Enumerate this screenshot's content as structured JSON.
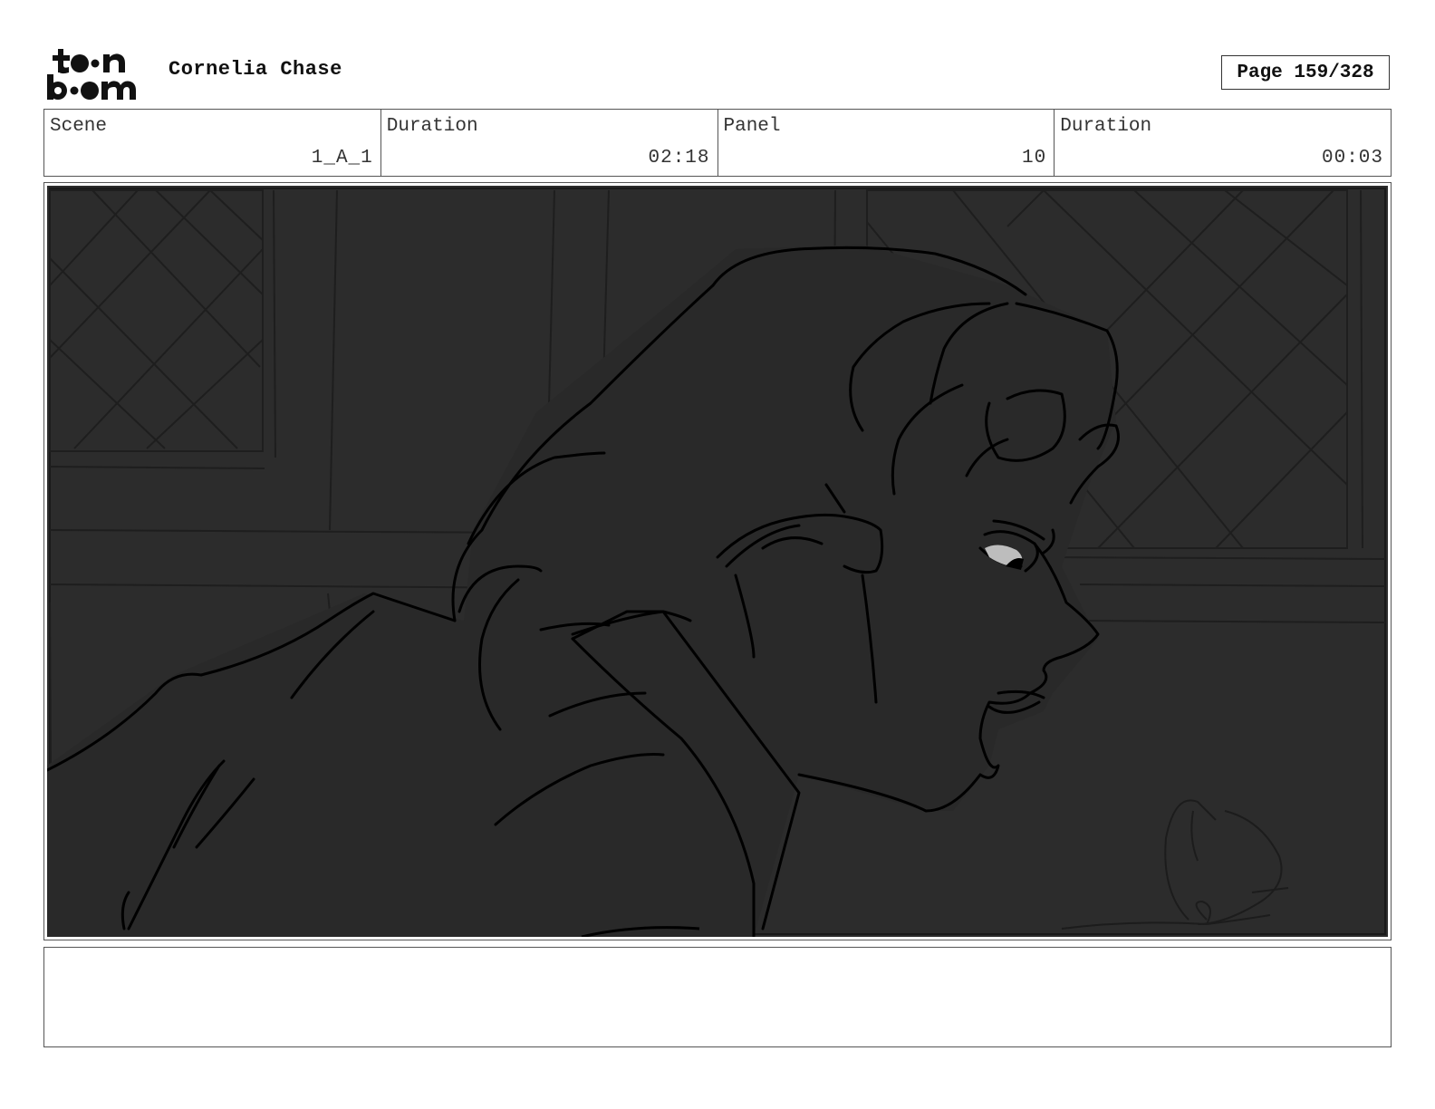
{
  "header": {
    "logo_text": "toon boom",
    "project_title": "Cornelia Chase",
    "page_label": "Page 159/328"
  },
  "info": {
    "scene_label": "Scene",
    "scene_value": "1_A_1",
    "scene_duration_label": "Duration",
    "scene_duration_value": "02:18",
    "panel_label": "Panel",
    "panel_value": "10",
    "panel_duration_label": "Duration",
    "panel_duration_value": "00:03"
  },
  "notes": {
    "text": ""
  },
  "colors": {
    "panel_background": "#2c2c2c",
    "figure_fill": "#2a2a2a",
    "line_color": "#000000",
    "background_line": "#1f1f1f",
    "eye_highlight": "#bdbdbd"
  }
}
